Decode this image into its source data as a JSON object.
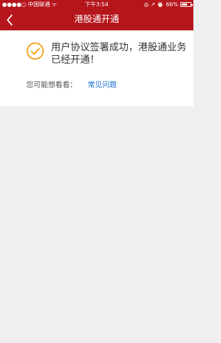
{
  "status_bar": {
    "signal": "●●●●○",
    "carrier": "中国联通",
    "wifi": "ᯤ",
    "time": "下午3:54",
    "icons": "◎ ↗ ⏰",
    "battery_text": "66%",
    "battery_level": 0.66
  },
  "nav": {
    "back_icon": "chevron-left",
    "title": "港股通开通"
  },
  "content": {
    "icon": "check-circle-icon",
    "message": "用户协议签署成功，港股通业务已经开通！",
    "suggest_label": "您可能想看看：",
    "faq_link": "常见问题"
  },
  "colors": {
    "primary": "#b5161c",
    "success_orange": "#f5a623",
    "link_blue": "#1a6fcf",
    "background": "#efefef"
  }
}
